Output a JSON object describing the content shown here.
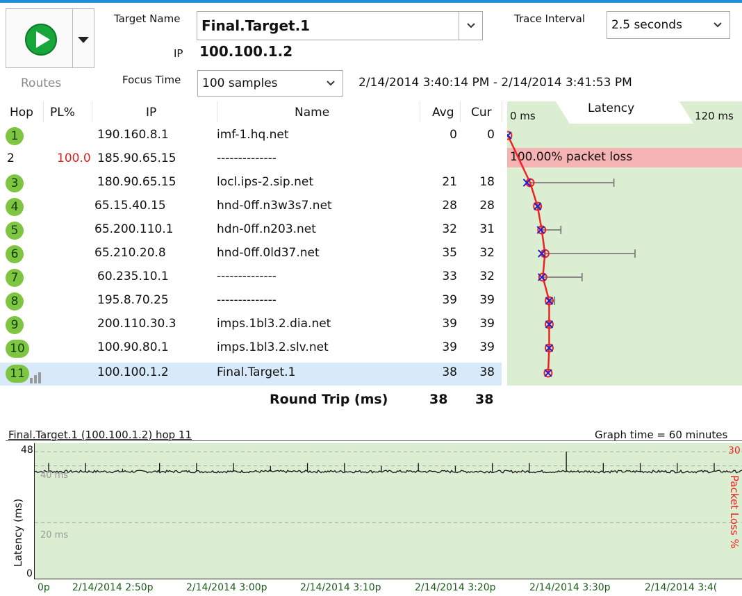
{
  "toolbar": {
    "routes_label": "Routes",
    "target_name_label": "Target Name",
    "target_name_value": "Final.Target.1",
    "ip_label": "IP",
    "ip_value": "100.100.1.2",
    "focus_time_label": "Focus Time",
    "focus_time_value": "100 samples",
    "time_range": "2/14/2014 3:40:14 PM - 2/14/2014 3:41:53 PM",
    "trace_interval_label": "Trace Interval",
    "trace_interval_value": "2.5 seconds"
  },
  "table": {
    "columns": {
      "hop": "Hop",
      "pl": "PL%",
      "ip": "IP",
      "name": "Name",
      "avg": "Avg",
      "cur": "Cur"
    },
    "latency_header": {
      "min": "0 ms",
      "title": "Latency",
      "max": "120 ms"
    },
    "rows": [
      {
        "hop": "1",
        "pl": "",
        "ip": "190.160.8.1",
        "name": "imf-1.hq.net",
        "avg": "0",
        "cur": "0"
      },
      {
        "hop": "2",
        "pl": "100.0",
        "ip": "185.90.65.15",
        "name": "--------------",
        "avg": "",
        "cur": ""
      },
      {
        "hop": "3",
        "pl": "",
        "ip": "180.90.65.15",
        "name": "locl.ips-2.sip.net",
        "avg": "21",
        "cur": "18"
      },
      {
        "hop": "4",
        "pl": "",
        "ip": "65.15.40.15",
        "name": "hnd-0ff.n3w3s7.net",
        "avg": "28",
        "cur": "28"
      },
      {
        "hop": "5",
        "pl": "",
        "ip": "65.200.110.1",
        "name": "hdn-0ff.n203.net",
        "avg": "32",
        "cur": "31"
      },
      {
        "hop": "6",
        "pl": "",
        "ip": "65.210.20.8",
        "name": "hnd-0ff.0ld37.net",
        "avg": "35",
        "cur": "32"
      },
      {
        "hop": "7",
        "pl": "",
        "ip": "60.235.10.1",
        "name": "--------------",
        "avg": "33",
        "cur": "32"
      },
      {
        "hop": "8",
        "pl": "",
        "ip": "195.8.70.25",
        "name": "--------------",
        "avg": "39",
        "cur": "39"
      },
      {
        "hop": "9",
        "pl": "",
        "ip": "200.110.30.3",
        "name": "imps.1bl3.2.dia.net",
        "avg": "39",
        "cur": "39"
      },
      {
        "hop": "10",
        "pl": "",
        "ip": "100.90.80.1",
        "name": "imps.1bl3.2.slv.net",
        "avg": "39",
        "cur": "39"
      },
      {
        "hop": "11",
        "pl": "",
        "ip": "100.100.1.2",
        "name": "Final.Target.1",
        "avg": "38",
        "cur": "38"
      }
    ],
    "packet_loss_text": "100.00% packet loss",
    "round_trip_label": "Round Trip (ms)",
    "round_trip_avg": "38",
    "round_trip_cur": "38"
  },
  "colors": {
    "accent": "#1f8fd6",
    "hop_badge": "#7ec641",
    "latency_bg": "#dbeed2",
    "packet_loss_bg": "#f6b3b3",
    "trace_line": "#ee2222",
    "marker_x": "#2222cc",
    "selected_row": "#d8eaf9"
  },
  "chart_data": [
    {
      "type": "line",
      "title": "",
      "x_unit": "ms",
      "xlim": [
        0,
        120
      ],
      "latency_range": {
        "min": "0 ms",
        "max": "120 ms"
      },
      "series": [
        {
          "name": "Avg",
          "values": [
            0,
            null,
            21,
            28,
            32,
            35,
            33,
            39,
            39,
            39,
            38
          ]
        },
        {
          "name": "Cur",
          "values": [
            0,
            null,
            18,
            28,
            31,
            32,
            32,
            39,
            39,
            39,
            38
          ]
        }
      ],
      "max_whisker": [
        0,
        null,
        100,
        30,
        50,
        120,
        70,
        44,
        39,
        39,
        38
      ],
      "categories": [
        "1",
        "2",
        "3",
        "4",
        "5",
        "6",
        "7",
        "8",
        "9",
        "10",
        "11"
      ]
    },
    {
      "type": "line",
      "title": "Final.Target.1 (100.100.1.2) hop 11",
      "subtitle": "Graph time = 60 minutes",
      "ylabel": "Latency (ms)",
      "y2label": "Packet Loss %",
      "ylim": [
        0,
        48
      ],
      "y2_top": "30",
      "y_ticks": [
        "48",
        "0"
      ],
      "gridlines": [
        "40 ms",
        "20 ms"
      ],
      "x_tick_labels": [
        "0p",
        "2/14/2014 2:50p",
        "2/14/2014 3:00p",
        "2/14/2014 3:10p",
        "2/14/2014 3:20p",
        "2/14/2014 3:30p",
        "2/14/2014 3:4("
      ],
      "series": [
        {
          "name": "Latency",
          "baseline": 38,
          "spikes": [
            41,
            41,
            39,
            41,
            41,
            41,
            40,
            41,
            41,
            40,
            41,
            40,
            41,
            41,
            45,
            41,
            41,
            41,
            41
          ]
        }
      ]
    }
  ]
}
